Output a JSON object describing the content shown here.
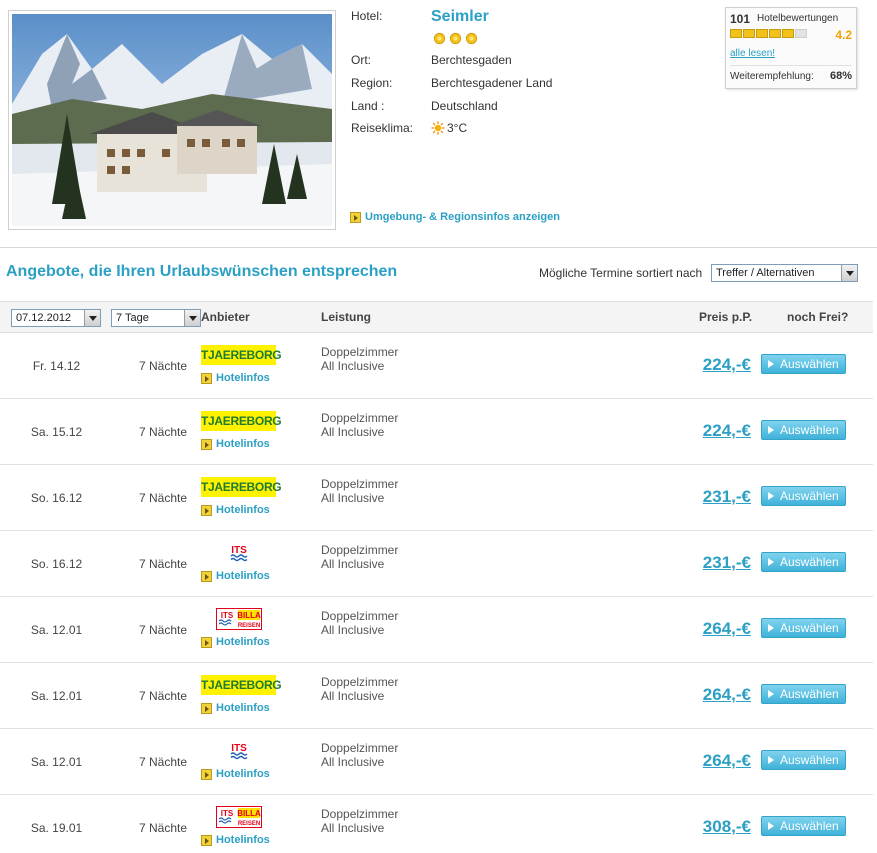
{
  "hotel": {
    "name_label": "Hotel:",
    "name": "Seimler",
    "stars": 3,
    "location_label": "Ort:",
    "location": "Berchtesgaden",
    "region_label": "Region:",
    "region": "Berchtesgadener Land",
    "country_label": "Land :",
    "country": "Deutschland",
    "climate_label": "Reiseklima:",
    "climate": "3°C",
    "climate_icon": "sun-icon",
    "region_link": "Umgebung- & Regionsinfos anzeigen"
  },
  "rating": {
    "count": "101",
    "count_label": "Hotelbewertungen",
    "score": "4.2",
    "score_fraction": 0.84,
    "read_all": "alle lesen!",
    "recommend_label": "Weiterempfehlung:",
    "recommend_value": "68%"
  },
  "offers": {
    "title": "Angebote, die Ihren Urlaubswünschen entsprechen",
    "sort_label": "Mögliche Termine sortiert nach",
    "sort_value": "Treffer / Alternativen"
  },
  "table": {
    "date_select": "07.12.2012",
    "duration_select": "7 Tage",
    "col_provider": "Anbieter",
    "col_service": "Leistung",
    "col_price": "Preis p.P.",
    "col_free": "noch Frei?"
  },
  "rows": [
    {
      "date": "Fr. 14.12",
      "nights": "7 Nächte",
      "provider": "tjaereborg",
      "provider_text": "TJAEREBORG",
      "hotelinfo": "Hotelinfos",
      "room": "Doppelzimmer",
      "board": "All Inclusive",
      "price": "224,-€",
      "button": "Auswählen"
    },
    {
      "date": "Sa. 15.12",
      "nights": "7 Nächte",
      "provider": "tjaereborg",
      "provider_text": "TJAEREBORG",
      "hotelinfo": "Hotelinfos",
      "room": "Doppelzimmer",
      "board": "All Inclusive",
      "price": "224,-€",
      "button": "Auswählen"
    },
    {
      "date": "So. 16.12",
      "nights": "7 Nächte",
      "provider": "tjaereborg",
      "provider_text": "TJAEREBORG",
      "hotelinfo": "Hotelinfos",
      "room": "Doppelzimmer",
      "board": "All Inclusive",
      "price": "231,-€",
      "button": "Auswählen"
    },
    {
      "date": "So. 16.12",
      "nights": "7 Nächte",
      "provider": "its",
      "provider_text": "ITS",
      "hotelinfo": "Hotelinfos",
      "room": "Doppelzimmer",
      "board": "All Inclusive",
      "price": "231,-€",
      "button": "Auswählen"
    },
    {
      "date": "Sa. 12.01",
      "nights": "7 Nächte",
      "provider": "itsbilla",
      "provider_text": "ITS BILLA REISEN",
      "hotelinfo": "Hotelinfos",
      "room": "Doppelzimmer",
      "board": "All Inclusive",
      "price": "264,-€",
      "button": "Auswählen"
    },
    {
      "date": "Sa. 12.01",
      "nights": "7 Nächte",
      "provider": "tjaereborg",
      "provider_text": "TJAEREBORG",
      "hotelinfo": "Hotelinfos",
      "room": "Doppelzimmer",
      "board": "All Inclusive",
      "price": "264,-€",
      "button": "Auswählen"
    },
    {
      "date": "Sa. 12.01",
      "nights": "7 Nächte",
      "provider": "its",
      "provider_text": "ITS",
      "hotelinfo": "Hotelinfos",
      "room": "Doppelzimmer",
      "board": "All Inclusive",
      "price": "264,-€",
      "button": "Auswählen"
    },
    {
      "date": "Sa. 19.01",
      "nights": "7 Nächte",
      "provider": "itsbilla",
      "provider_text": "ITS BILLA REISEN",
      "hotelinfo": "Hotelinfos",
      "room": "Doppelzimmer",
      "board": "All Inclusive",
      "price": "308,-€",
      "button": "Auswählen"
    }
  ],
  "colors": {
    "accent": "#2ba0c4",
    "button": "#3fb2d9",
    "star": "#f2c21a",
    "tjaereborg_bg": "#fff200",
    "tjaereborg_text": "#1d7c2e",
    "its_red": "#e2001a"
  }
}
